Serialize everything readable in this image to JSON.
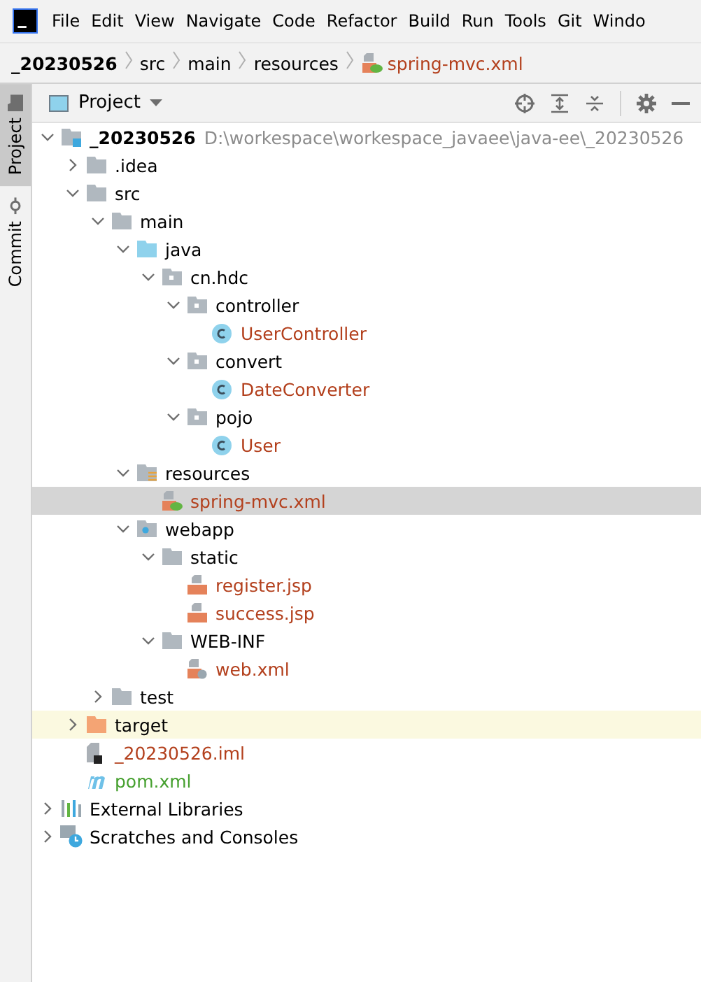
{
  "menu_bar": {
    "items": [
      "File",
      "Edit",
      "View",
      "Navigate",
      "Code",
      "Refactor",
      "Build",
      "Run",
      "Tools",
      "Git",
      "Windo"
    ]
  },
  "breadcrumbs": [
    {
      "label": "_20230526",
      "kind": "module"
    },
    {
      "label": "src",
      "kind": "folder"
    },
    {
      "label": "main",
      "kind": "folder"
    },
    {
      "label": "resources",
      "kind": "folder"
    },
    {
      "label": "spring-mvc.xml",
      "kind": "xml"
    }
  ],
  "side_tabs": [
    {
      "label": "Project",
      "selected": true
    },
    {
      "label": "Commit",
      "selected": false
    }
  ],
  "panel": {
    "title": "Project"
  },
  "tree": [
    {
      "label": "_20230526",
      "kind": "module",
      "hint": "D:\\workespace\\workespace_javaee\\java-ee\\_20230526",
      "expanded": true,
      "selected": false,
      "children": [
        {
          "label": ".idea",
          "kind": "folder",
          "expanded": false,
          "selected": false
        },
        {
          "label": "src",
          "kind": "folder",
          "expanded": true,
          "selected": false,
          "children": [
            {
              "label": "main",
              "kind": "folder",
              "expanded": true,
              "selected": false,
              "children": [
                {
                  "label": "java",
                  "kind": "source",
                  "expanded": true,
                  "selected": false,
                  "children": [
                    {
                      "label": "cn.hdc",
                      "kind": "package",
                      "expanded": true,
                      "selected": false,
                      "children": [
                        {
                          "label": "controller",
                          "kind": "package",
                          "expanded": true,
                          "selected": false,
                          "children": [
                            {
                              "label": "UserController",
                              "kind": "class",
                              "color": "#b3401d",
                              "selected": false
                            }
                          ]
                        },
                        {
                          "label": "convert",
                          "kind": "package",
                          "expanded": true,
                          "selected": false,
                          "children": [
                            {
                              "label": "DateConverter",
                              "kind": "class",
                              "color": "#b3401d",
                              "selected": false
                            }
                          ]
                        },
                        {
                          "label": "pojo",
                          "kind": "package",
                          "expanded": true,
                          "selected": false,
                          "children": [
                            {
                              "label": "User",
                              "kind": "class",
                              "color": "#b3401d",
                              "selected": false
                            }
                          ]
                        }
                      ]
                    }
                  ]
                },
                {
                  "label": "resources",
                  "kind": "resources",
                  "expanded": true,
                  "selected": false,
                  "children": [
                    {
                      "label": "spring-mvc.xml",
                      "kind": "xml",
                      "color": "#b3401d",
                      "selected": true
                    }
                  ]
                },
                {
                  "label": "webapp",
                  "kind": "web",
                  "expanded": true,
                  "selected": false,
                  "children": [
                    {
                      "label": "static",
                      "kind": "folder",
                      "expanded": true,
                      "selected": false,
                      "children": [
                        {
                          "label": "register.jsp",
                          "kind": "jsp",
                          "color": "#b3401d",
                          "selected": false
                        },
                        {
                          "label": "success.jsp",
                          "kind": "jsp",
                          "color": "#b3401d",
                          "selected": false
                        }
                      ]
                    },
                    {
                      "label": "WEB-INF",
                      "kind": "folder",
                      "expanded": true,
                      "selected": false,
                      "children": [
                        {
                          "label": "web.xml",
                          "kind": "webxml",
                          "color": "#b3401d",
                          "selected": false
                        }
                      ]
                    }
                  ]
                }
              ]
            },
            {
              "label": "test",
              "kind": "folder",
              "expanded": false,
              "selected": false
            }
          ]
        },
        {
          "label": "target",
          "kind": "excluded",
          "expanded": false,
          "selected": false,
          "highlighted": true
        },
        {
          "label": "_20230526.iml",
          "kind": "iml",
          "color": "#b3401d",
          "selected": false
        },
        {
          "label": "pom.xml",
          "kind": "pom",
          "color": "#46a02f",
          "selected": false
        }
      ]
    },
    {
      "label": "External Libraries",
      "kind": "libraries",
      "expanded": false,
      "selected": false
    },
    {
      "label": "Scratches and Consoles",
      "kind": "scratches",
      "expanded": false,
      "selected": false
    }
  ]
}
